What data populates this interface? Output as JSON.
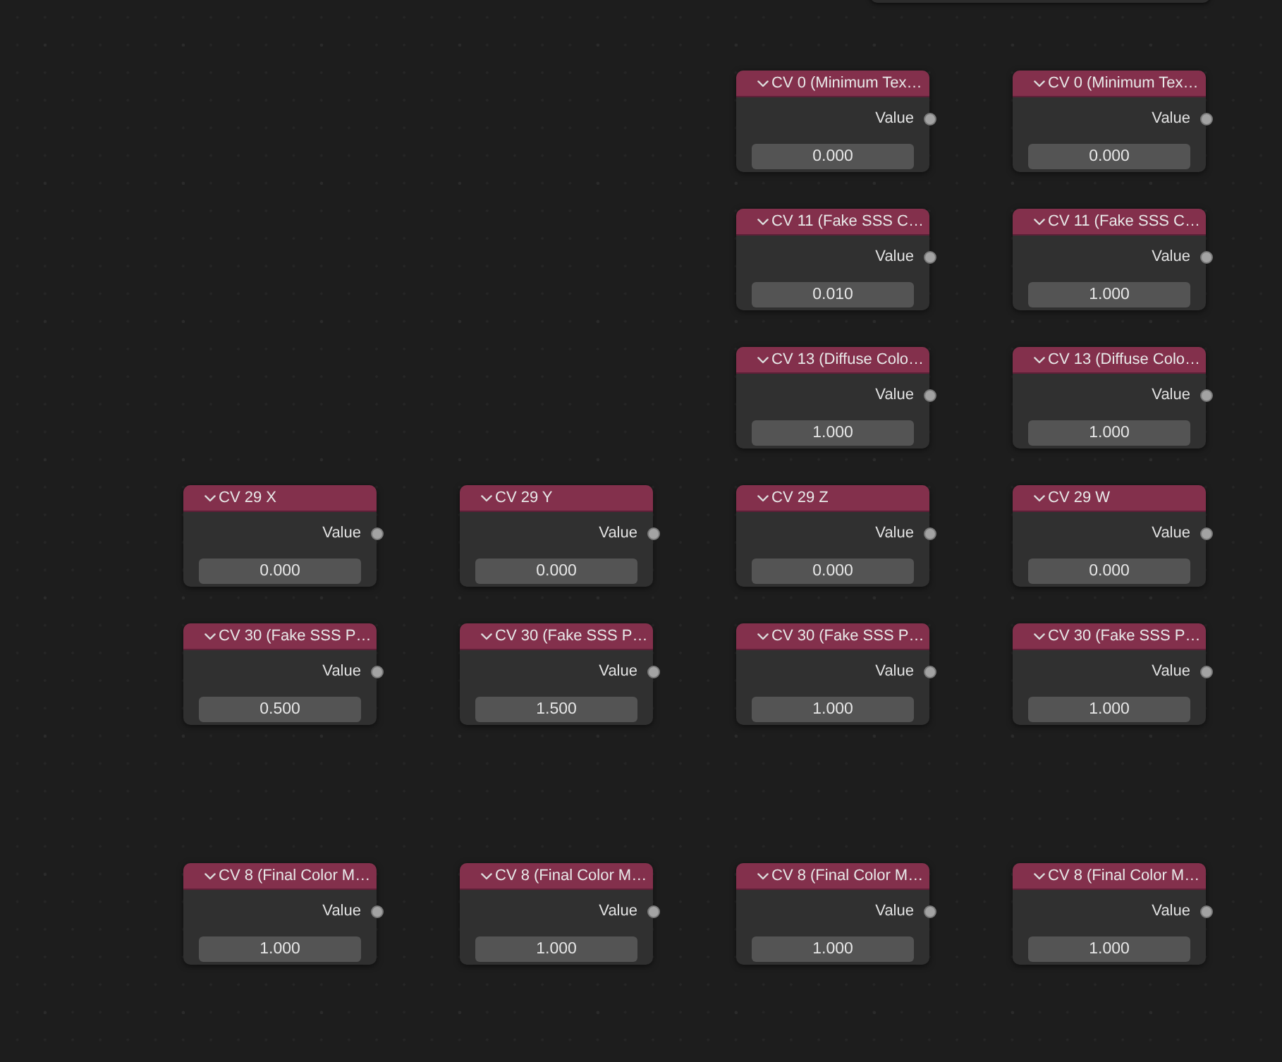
{
  "node_rows": [
    {
      "nodes": [
        {
          "title": "CV 0 (Minimum Tex…",
          "output": "Value",
          "value": "0.000"
        },
        {
          "title": "CV 0 (Minimum Tex…",
          "output": "Value",
          "value": "0.000"
        }
      ]
    },
    {
      "nodes": [
        {
          "title": "CV 11 (Fake SSS C…",
          "output": "Value",
          "value": "0.010"
        },
        {
          "title": "CV 11 (Fake SSS C…",
          "output": "Value",
          "value": "1.000"
        }
      ]
    },
    {
      "nodes": [
        {
          "title": "CV 13 (Diffuse Colo…",
          "output": "Value",
          "value": "1.000"
        },
        {
          "title": "CV 13 (Diffuse Colo…",
          "output": "Value",
          "value": "1.000"
        }
      ]
    },
    {
      "nodes": [
        {
          "title": "CV 29 X",
          "output": "Value",
          "value": "0.000"
        },
        {
          "title": "CV 29 Y",
          "output": "Value",
          "value": "0.000"
        },
        {
          "title": "CV 29 Z",
          "output": "Value",
          "value": "0.000"
        },
        {
          "title": "CV 29 W",
          "output": "Value",
          "value": "0.000"
        }
      ]
    },
    {
      "nodes": [
        {
          "title": "CV 30 (Fake SSS P…",
          "output": "Value",
          "value": "0.500"
        },
        {
          "title": "CV 30 (Fake SSS P…",
          "output": "Value",
          "value": "1.500"
        },
        {
          "title": "CV 30 (Fake SSS P…",
          "output": "Value",
          "value": "1.000"
        },
        {
          "title": "CV 30 (Fake SSS P…",
          "output": "Value",
          "value": "1.000"
        }
      ]
    },
    {
      "nodes": [
        {
          "title": "CV 8 (Final Color M…",
          "output": "Value",
          "value": "1.000"
        },
        {
          "title": "CV 8 (Final Color M…",
          "output": "Value",
          "value": "1.000"
        },
        {
          "title": "CV 8 (Final Color M…",
          "output": "Value",
          "value": "1.000"
        },
        {
          "title": "CV 8 (Final Color M…",
          "output": "Value",
          "value": "1.000"
        }
      ]
    }
  ]
}
